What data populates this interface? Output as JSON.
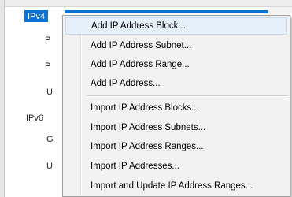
{
  "tree": {
    "items": [
      {
        "label": "IPv4",
        "selected": true
      },
      {
        "label": "P"
      },
      {
        "label": "P"
      },
      {
        "label": "U"
      },
      {
        "label": "IPv6"
      },
      {
        "label": "G"
      },
      {
        "label": "U"
      }
    ]
  },
  "context_menu": {
    "items": [
      {
        "label": "Add IP Address Block..."
      },
      {
        "label": "Add IP Address Subnet..."
      },
      {
        "label": "Add IP Address Range..."
      },
      {
        "label": "Add IP Address..."
      },
      {
        "label": "Import IP Address Blocks..."
      },
      {
        "label": "Import IP Address Subnets..."
      },
      {
        "label": "Import IP Address Ranges..."
      },
      {
        "label": "Import IP Addresses..."
      },
      {
        "label": "Import and Update IP Address Ranges..."
      }
    ]
  },
  "colors": {
    "selection": "#0c73d4",
    "menu_bg": "#f2f2f2",
    "hover_bg": "#e6f0fb"
  }
}
